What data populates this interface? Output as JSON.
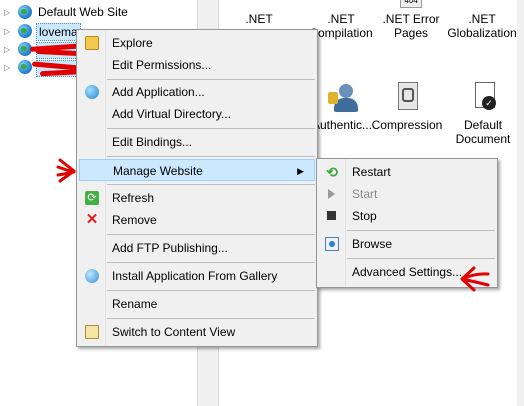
{
  "tree": {
    "items": [
      {
        "label": "Default Web Site"
      },
      {
        "label": "lovema"
      },
      {
        "label": ""
      },
      {
        "label": ""
      }
    ]
  },
  "features": [
    {
      "label": ".NET",
      "sublabel": "",
      "icon": "dotnet-icon"
    },
    {
      "label": ".NET",
      "sublabel": "Compilation",
      "icon": "dotnet-compilation-icon"
    },
    {
      "label": ".NET Error",
      "sublabel": "Pages",
      "icon": "error-pages-icon",
      "badge": "404"
    },
    {
      "label": ".NET",
      "sublabel": "Globalization",
      "icon": "globalization-icon"
    },
    {
      "label": "Authentic...",
      "sublabel": "",
      "icon": "authentication-icon"
    },
    {
      "label": "Compression",
      "sublabel": "",
      "icon": "compression-icon"
    },
    {
      "label": "Default",
      "sublabel": "Document",
      "icon": "default-document-icon"
    }
  ],
  "context_menu": {
    "items": [
      {
        "label": "Explore",
        "icon": "explore-icon"
      },
      {
        "label": "Edit Permissions..."
      },
      {
        "label": "Add Application...",
        "icon": "add-application-icon"
      },
      {
        "label": "Add Virtual Directory..."
      },
      {
        "label": "Edit Bindings..."
      },
      {
        "label": "Manage Website",
        "submenu_arrow": "▶"
      },
      {
        "label": "Refresh",
        "icon": "refresh-icon"
      },
      {
        "label": "Remove",
        "icon": "remove-icon"
      },
      {
        "label": "Add FTP Publishing..."
      },
      {
        "label": "Install Application From Gallery",
        "icon": "gallery-icon"
      },
      {
        "label": "Rename"
      },
      {
        "label": "Switch to Content View",
        "icon": "content-view-icon"
      }
    ]
  },
  "submenu": {
    "items": [
      {
        "label": "Restart",
        "icon": "restart-icon"
      },
      {
        "label": "Start",
        "icon": "start-icon",
        "disabled": true
      },
      {
        "label": "Stop",
        "icon": "stop-icon"
      },
      {
        "label": "Browse",
        "icon": "browse-icon"
      },
      {
        "label": "Advanced Settings..."
      }
    ]
  },
  "colors": {
    "highlight": "#cce8ff",
    "annotation_red": "#e00000",
    "menu_background": "#f0f0f0"
  }
}
